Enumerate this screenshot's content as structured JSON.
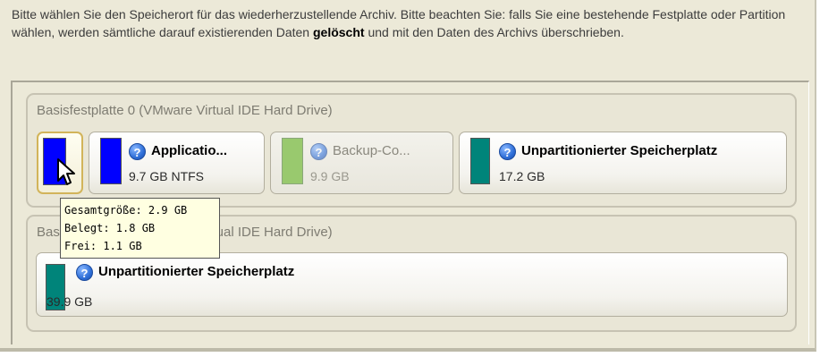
{
  "instructions": {
    "text_before": "Bitte wählen Sie den Speicherort für das wiederherzustellende Archiv. Bitte beachten Sie: falls Sie eine bestehende Festplatte oder Partition wählen, werden sämtliche darauf existierenden Daten ",
    "text_bold": "gelöscht",
    "text_after": " und mit den Daten des Archivs überschrieben."
  },
  "disks": [
    {
      "title": "Basisfestplatte 0 (VMware Virtual IDE Hard Drive)",
      "partitions": [
        {
          "label": "",
          "size": "",
          "color": "#0000ff",
          "selected": true
        },
        {
          "label": "Applicatio...",
          "size": "9.7 GB NTFS",
          "color": "#0000ff"
        },
        {
          "label": "Backup-Co...",
          "size": "9.9 GB",
          "color": "#99c96e",
          "disabled": true
        },
        {
          "label": "Unpartitionierter Speicherplatz",
          "size": "17.2 GB",
          "color": "#00847a"
        }
      ]
    },
    {
      "title": "Basisfestplatte 1 (VMware Virtual IDE Hard Drive)",
      "partitions": [
        {
          "label": "Unpartitionierter Speicherplatz",
          "size": "39.9 GB",
          "color": "#00847a"
        }
      ]
    }
  ],
  "tooltip": {
    "line1": "Gesamtgröße: 2.9 GB",
    "line2": "Belegt: 1.8 GB",
    "line3": "Frei: 1.1 GB"
  },
  "icons": {
    "help": "question-icon",
    "cursor": "mouse-pointer-icon"
  }
}
